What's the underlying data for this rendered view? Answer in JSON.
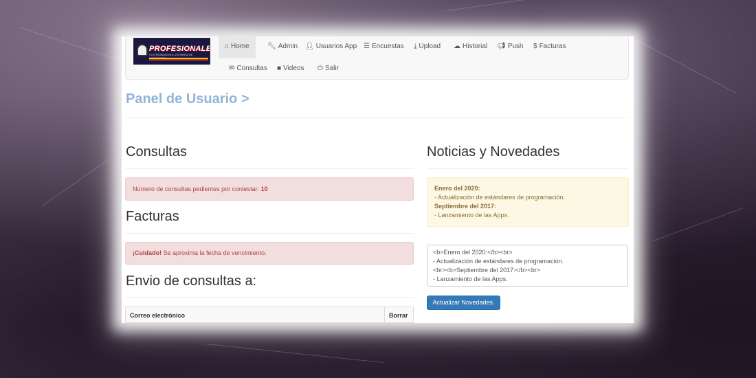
{
  "logo": {
    "title": "PROFESIONALES",
    "subtitle": "COORDINADORA UNITARIA DE BOMBEROS"
  },
  "nav": {
    "items": [
      {
        "label": "Home",
        "icon": "home-icon"
      },
      {
        "label": "Admin",
        "icon": "wrench-icon"
      },
      {
        "label": "Usuarios App",
        "icon": "user-icon"
      },
      {
        "label": "Encuestas",
        "icon": "list-icon"
      },
      {
        "label": "Upload",
        "icon": "download-icon"
      },
      {
        "label": "Historial",
        "icon": "cloud-icon"
      },
      {
        "label": "Push",
        "icon": "bullhorn-icon"
      },
      {
        "label": "Facturas",
        "icon": "dollar-icon"
      },
      {
        "label": "Consultas",
        "icon": "envelope-icon"
      },
      {
        "label": "Videos",
        "icon": "video-camera-icon"
      },
      {
        "label": "Salir",
        "icon": "power-icon"
      }
    ]
  },
  "page": {
    "title": "Panel de Usuario >"
  },
  "consultas": {
    "heading": "Consultas",
    "alert_text": "Número de consultas pedientes por contestar: ",
    "alert_count": "10"
  },
  "facturas": {
    "heading": "Facturas",
    "alert_bold": "¡Cuidado!",
    "alert_text": " Se aproxima la fecha de vencimiento."
  },
  "envio": {
    "heading": "Envio de consultas a:",
    "columns": [
      "Correo electrónico",
      "Borrar"
    ]
  },
  "noticias": {
    "heading": "Noticias y Novedades",
    "entries": [
      {
        "date": "Enero del 2020:",
        "text": "- Actualización de estándares de programación."
      },
      {
        "date": "Septiembre del 2017:",
        "text": "- Lanzamiento de las Apps."
      }
    ],
    "textarea_value": "<b>Enero del 2020:</b><br>\n- Actualización de estándares de programación.\n<br><b>Septiembre del 2017:</b><br>\n- Lanzamiento de las Apps.",
    "button_label": "Actualizar Novedades."
  },
  "colors": {
    "title_blue": "#92b4d9",
    "primary": "#337ab7",
    "danger_bg": "#f2dede",
    "warning_bg": "#fcf8e3"
  }
}
